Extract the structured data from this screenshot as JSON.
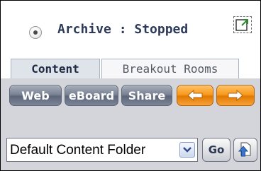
{
  "header": {
    "status_icon": "recording-status-icon",
    "archive_status": "Archive : Stopped",
    "popout_icon": "popout-window-icon"
  },
  "tabs": [
    {
      "label": "Content",
      "selected": true
    },
    {
      "label": "Breakout Rooms",
      "selected": false
    }
  ],
  "toolbar": {
    "web_label": "Web",
    "eboard_label": "eBoard",
    "share_label": "Share",
    "back_icon": "arrow-left-icon",
    "forward_icon": "arrow-right-icon"
  },
  "folder": {
    "selected": "Default Content Folder",
    "go_label": "Go",
    "up_icon": "folder-up-icon"
  },
  "colors": {
    "toolbar_bg": "#d3d5db",
    "gray_button": "#7a8394",
    "orange_button": "#f79a1e",
    "tab_selected_bg": "#dfe3ea",
    "title_text": "#2e3a5a"
  }
}
